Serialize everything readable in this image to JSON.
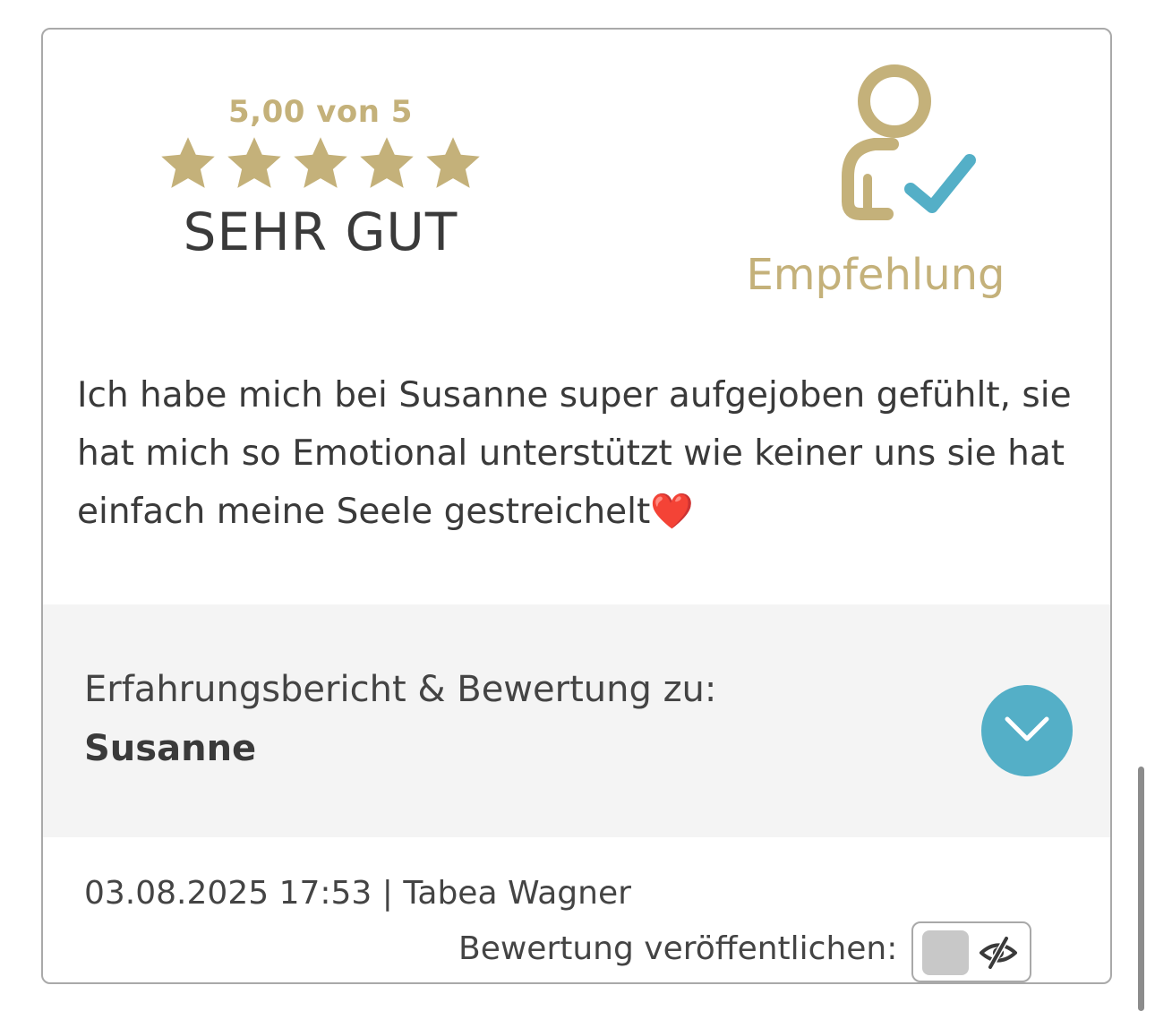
{
  "rating": {
    "score_text": "5,00 von 5",
    "stars_filled": 5,
    "stars_total": 5,
    "verdict": "SEHR GUT"
  },
  "recommendation": {
    "icon": "user-check-icon",
    "label": "Empfehlung"
  },
  "review": {
    "text": "Ich habe mich bei Susanne super aufgejoben gefühlt, sie hat mich so Emotional unterstützt wie keiner uns sie hat einfach meine Seele gestreichelt",
    "emoji": "❤️"
  },
  "about": {
    "label": "Erfahrungsbericht & Bewertung zu:",
    "name": "Susanne"
  },
  "meta": {
    "date": "03.08.2025 17:53",
    "separator": "|",
    "author": "Tabea Wagner"
  },
  "publish": {
    "label": "Bewertung veröffentlichen:",
    "enabled": false
  },
  "colors": {
    "gold": "#c4b17a",
    "teal": "#54afc7",
    "text": "#3a3a3a"
  }
}
